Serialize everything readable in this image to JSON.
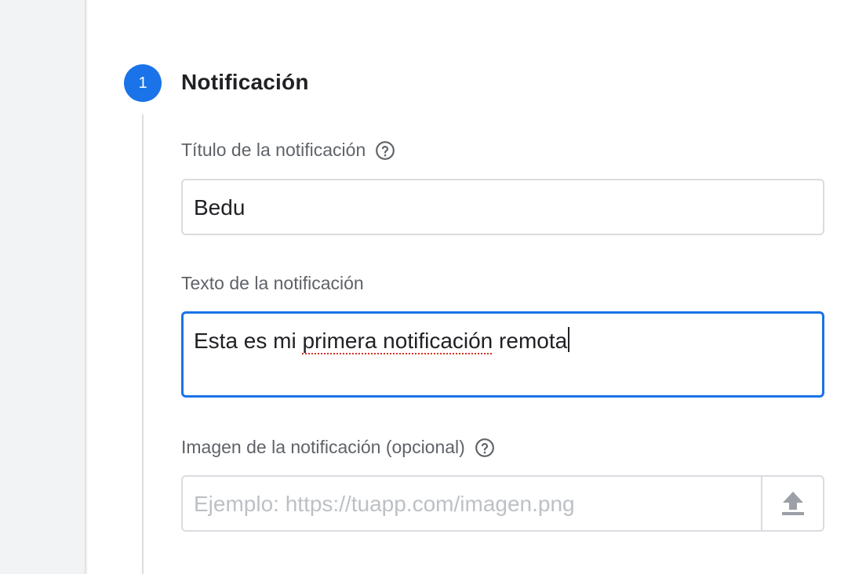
{
  "step": {
    "number": "1",
    "title": "Notificación"
  },
  "fields": {
    "title": {
      "label": "Título de la notificación",
      "value": "Bedu"
    },
    "text": {
      "label": "Texto de la notificación",
      "value_before": "Esta es mi ",
      "value_misspelled": "primera notificación",
      "value_after": " remota"
    },
    "image": {
      "label": "Imagen de la notificación (opcional)",
      "placeholder": "Ejemplo: https://tuapp.com/imagen.png"
    }
  },
  "icons": {
    "help": "help-circle-icon",
    "upload": "upload-icon"
  },
  "colors": {
    "accent": "#1a73e8",
    "label": "#5f6368",
    "border": "#dadce0",
    "spellcheck": "#d93025"
  }
}
